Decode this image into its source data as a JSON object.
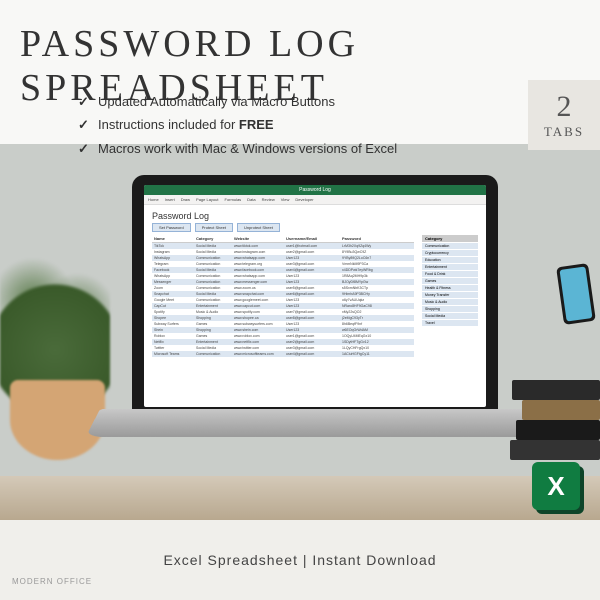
{
  "title": "PASSWORD LOG SPREADSHEET",
  "bullets": {
    "b1": "Updated Automatically via Macro Buttons",
    "b2_pre": "Instructions included for ",
    "b2_free": "FREE",
    "b3": "Macros work with Mac & Windows versions of Excel"
  },
  "badge": {
    "num": "2",
    "label": "TABS"
  },
  "excel": {
    "filename": "Password Log",
    "menus": [
      "Home",
      "Insert",
      "Draw",
      "Page Layout",
      "Formulas",
      "Data",
      "Review",
      "View",
      "Developer"
    ],
    "sheet_title": "Password Log",
    "buttons": {
      "set": "Set Password",
      "protect": "Protect Sheet",
      "unprotect": "Unprotect Sheet"
    },
    "headers": {
      "c1": "Name",
      "c2": "Category",
      "c3": "Website",
      "c4": "Username/Email",
      "c5": "Password"
    },
    "rows": [
      {
        "n": "TikTok",
        "c": "Social Media",
        "w": "www.tiktok.com",
        "u": "user1@hotmail.com",
        "p": "LrM3h2Xq9Zq4Wy"
      },
      {
        "n": "Instagram",
        "c": "Social Media",
        "w": "www.instagram.com",
        "u": "user2@gmail.com",
        "p": "8Y9Bu3QwC9Z"
      },
      {
        "n": "WhatsApp",
        "c": "Communication",
        "w": "www.whatsapp.com",
        "u": "User123",
        "p": "9YBy89Q2LoC6n7"
      },
      {
        "n": "Telegram",
        "c": "Communication",
        "w": "www.telegram.org",
        "u": "user3@gmail.com",
        "p": "VmmNkM9P3Ca"
      },
      {
        "n": "Facebook",
        "c": "Social Media",
        "w": "www.facebook.com",
        "u": "user4@gmail.com",
        "p": "x4DDPwk7eyWRbg"
      },
      {
        "n": "WhatsApp",
        "c": "Communication",
        "w": "www.whatsapp.com",
        "u": "User123",
        "p": "1R8Aq2MH9p3k"
      },
      {
        "n": "Messenger",
        "c": "Communication",
        "w": "www.messenger.com",
        "u": "User123",
        "p": "BJOyDf8MYpGw"
      },
      {
        "n": "Zoom",
        "c": "Communication",
        "w": "www.zoom.us",
        "u": "user5@gmail.com",
        "p": "s5SxmNbK3CTp"
      },
      {
        "n": "Snapchat",
        "c": "Social Media",
        "w": "www.snapchat.com",
        "u": "user6@gmail.com",
        "p": "9HimhA9P3BCHy"
      },
      {
        "n": "Google Meet",
        "c": "Communication",
        "w": "www.googlemeet.com",
        "u": "User123",
        "p": "o6y7vAUUqkz"
      },
      {
        "n": "CapCut",
        "c": "Entertainment",
        "w": "www.capcut.com",
        "u": "User123",
        "p": "NRaro8HF9GaC98"
      },
      {
        "n": "Spotify",
        "c": "Music & Audio",
        "w": "www.spotify.com",
        "u": "user7@gmail.com",
        "p": "xMy22sQO2"
      },
      {
        "n": "Shopee",
        "c": "Shopping",
        "w": "www.shopee.ca",
        "u": "user8@gmail.com",
        "p": "j2eMgC93yTr"
      },
      {
        "n": "Subway Surfers",
        "c": "Games",
        "w": "www.subwaysurfers.com",
        "u": "User123",
        "p": "8h6BeqfF9nf"
      },
      {
        "n": "Shein",
        "c": "Shopping",
        "w": "www.shein.com",
        "u": "User123",
        "p": "w6EOqGrWdAM"
      },
      {
        "n": "Roblox",
        "c": "Games",
        "w": "www.roblox.com",
        "u": "user1@gmail.com",
        "p": "1OQyU4MEqGx10"
      },
      {
        "n": "Netflix",
        "c": "Entertainment",
        "w": "www.netflix.com",
        "u": "user2@gmail.com",
        "p": "1SDytHFTgGv12"
      },
      {
        "n": "Twitter",
        "c": "Social Media",
        "w": "www.twitter.com",
        "u": "user3@gmail.com",
        "p": "1LQyCHFrgQx10"
      },
      {
        "n": "Microsoft Teams",
        "c": "Communication",
        "w": "www.microsoftteams.com",
        "u": "user4@gmail.com",
        "p": "1ACiuHGFtgCy11"
      }
    ],
    "categories": [
      "Communication",
      "Cryptocurrency",
      "Education",
      "Entertainment",
      "Food & Drink",
      "Games",
      "Health & Fitness",
      "Money Transfer",
      "Music & Audio",
      "Shopping",
      "Social Media",
      "Travel"
    ],
    "cat_header": "Category"
  },
  "footer": "Excel Spreadsheet | Instant Download",
  "logo": "X",
  "watermark": "MODERN OFFICE"
}
